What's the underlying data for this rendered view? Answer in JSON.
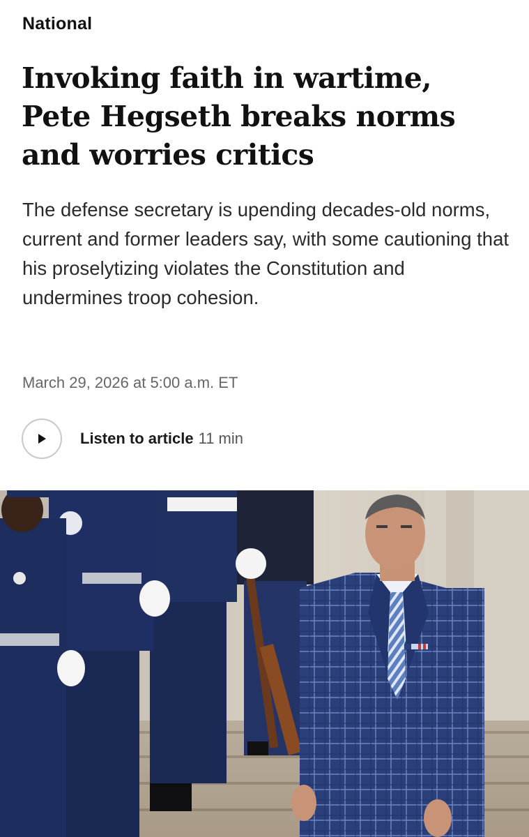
{
  "article": {
    "section": "National",
    "headline": "Invoking faith in wartime, Pete Hegseth breaks norms and worries critics",
    "dek": "The defense secretary is upending decades-old norms, current and former leaders say, with some cautioning that his proselytizing violates the Constitution and undermines troop cohesion.",
    "timestamp": "March 29, 2026 at 5:00 a.m. ET"
  },
  "audio": {
    "label": "Listen to article",
    "duration": "11 min",
    "icon": "play-icon"
  },
  "hero_image": {
    "icon": "photo"
  },
  "colors": {
    "text": "#111111",
    "muted": "#666666",
    "uniform_blue": "#1c2c5a",
    "suit_blue": "#2b3f7a"
  }
}
